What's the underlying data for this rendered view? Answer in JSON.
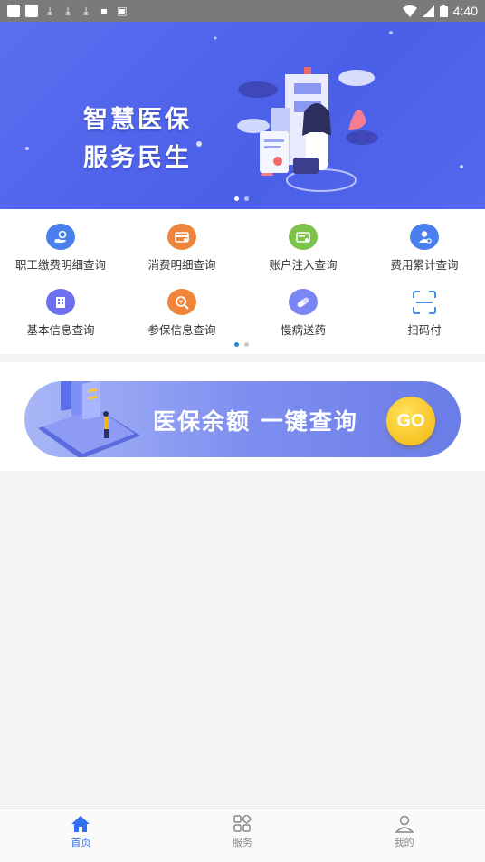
{
  "status_bar": {
    "time": "4:40"
  },
  "banner": {
    "line1": "智慧医保",
    "line2": "服务民生",
    "page_dots": 2,
    "active_dot": 0
  },
  "grid": {
    "items": [
      {
        "label": "职工缴费明细查询",
        "icon": "hand-coin-icon",
        "color": "#4a7ff0"
      },
      {
        "label": "消费明细查询",
        "icon": "card-receipt-icon",
        "color": "#f0843a"
      },
      {
        "label": "账户注入查询",
        "icon": "account-card-icon",
        "color": "#7cc34a"
      },
      {
        "label": "费用累计查询",
        "icon": "person-stats-icon",
        "color": "#4a7ff0"
      },
      {
        "label": "基本信息查询",
        "icon": "building-icon",
        "color": "#6c6ff0"
      },
      {
        "label": "参保信息查询",
        "icon": "search-yuan-icon",
        "color": "#f0843a"
      },
      {
        "label": "慢病送药",
        "icon": "pill-icon",
        "color": "#7b86f5"
      },
      {
        "label": "扫码付",
        "icon": "scan-icon",
        "color": "#4a8ef0"
      }
    ],
    "page_dots": 2,
    "active_dot": 0
  },
  "query_banner": {
    "text": "医保余额 一键查询",
    "go_label": "GO"
  },
  "tab_bar": {
    "tabs": [
      {
        "label": "首页",
        "icon": "home-icon",
        "active": true
      },
      {
        "label": "服务",
        "icon": "apps-grid-icon",
        "active": false
      },
      {
        "label": "我的",
        "icon": "person-icon",
        "active": false
      }
    ]
  }
}
